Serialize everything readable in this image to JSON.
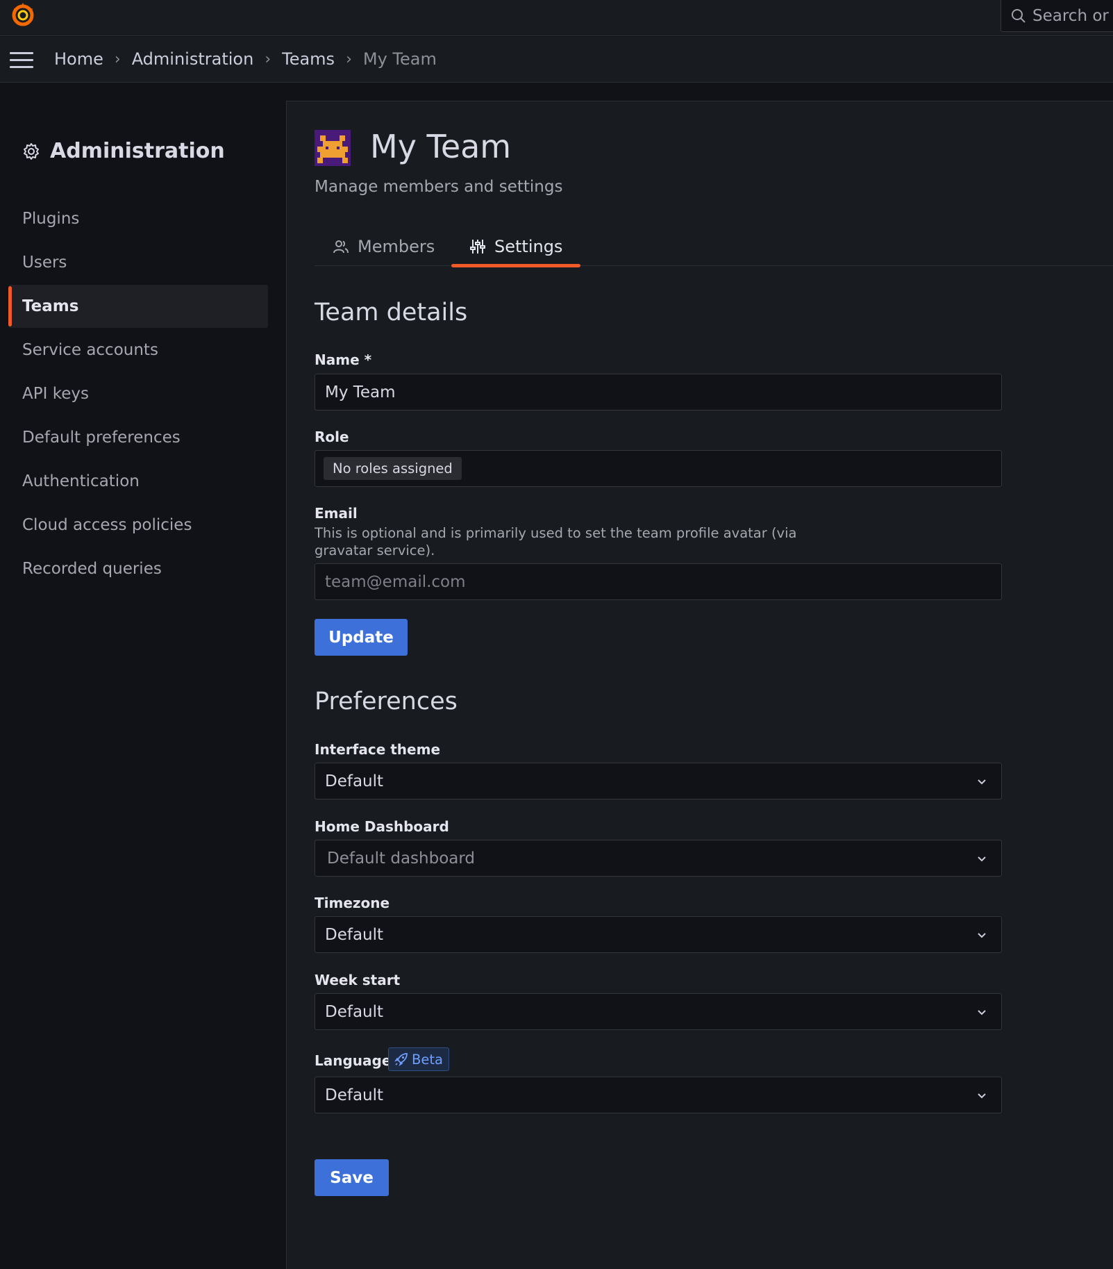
{
  "topbar": {
    "search_placeholder": "Search or jump to..."
  },
  "breadcrumb": [
    "Home",
    "Administration",
    "Teams",
    "My Team"
  ],
  "sidebar": {
    "title": "Administration",
    "items": [
      {
        "label": "Plugins",
        "active": false
      },
      {
        "label": "Users",
        "active": false
      },
      {
        "label": "Teams",
        "active": true
      },
      {
        "label": "Service accounts",
        "active": false
      },
      {
        "label": "API keys",
        "active": false
      },
      {
        "label": "Default preferences",
        "active": false
      },
      {
        "label": "Authentication",
        "active": false
      },
      {
        "label": "Cloud access policies",
        "active": false
      },
      {
        "label": "Recorded queries",
        "active": false
      }
    ]
  },
  "page": {
    "title": "My Team",
    "subtitle": "Manage members and settings",
    "tabs": [
      {
        "label": "Members",
        "icon": "users-icon",
        "active": false
      },
      {
        "label": "Settings",
        "icon": "sliders-icon",
        "active": true
      }
    ]
  },
  "team_details": {
    "heading": "Team details",
    "name_label": "Name *",
    "name_value": "My Team",
    "role_label": "Role",
    "role_value": "No roles assigned",
    "email_label": "Email",
    "email_description": "This is optional and is primarily used to set the team profile avatar (via gravatar service).",
    "email_placeholder": "team@email.com",
    "update_label": "Update"
  },
  "preferences": {
    "heading": "Preferences",
    "theme_label": "Interface theme",
    "theme_value": "Default",
    "home_dashboard_label": "Home Dashboard",
    "home_dashboard_value": "Default dashboard",
    "timezone_label": "Timezone",
    "timezone_value": "Default",
    "week_start_label": "Week start",
    "week_start_value": "Default",
    "language_label": "Language",
    "language_badge": "Beta",
    "language_value": "Default",
    "save_label": "Save"
  },
  "colors": {
    "accent": "#f05a28",
    "primary_button": "#3d71d9",
    "background": "#111217",
    "panel": "#181b1f"
  }
}
